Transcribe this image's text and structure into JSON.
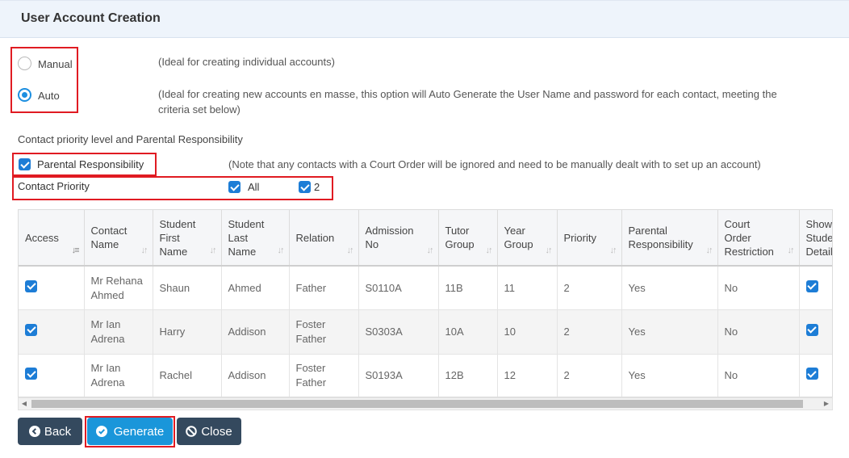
{
  "header": {
    "title": "User Account Creation"
  },
  "mode": {
    "manual": {
      "label": "Manual",
      "description": "(Ideal for creating individual accounts)",
      "selected": false
    },
    "auto": {
      "label": "Auto",
      "description_line1": "(Ideal for creating new accounts en masse, this option will Auto Generate the User Name and password for each contact, meeting the",
      "description_line2": "criteria set below)",
      "selected": true
    }
  },
  "priority_section": {
    "heading": "Contact priority level and Parental Responsibility",
    "parental_responsibility": {
      "label": "Parental Responsibility",
      "checked": true
    },
    "note": "(Note that any contacts with a Court Order will be ignored and need to be manually dealt with to set up an account)",
    "contact_priority": {
      "label": "Contact Priority",
      "options": [
        {
          "label": "All",
          "checked": true
        },
        {
          "label": "2",
          "checked": true
        }
      ]
    }
  },
  "table": {
    "columns": [
      {
        "l1": "Access",
        "l2": "",
        "l3": ""
      },
      {
        "l1": "Contact",
        "l2": "Name",
        "l3": ""
      },
      {
        "l1": "Student",
        "l2": "First",
        "l3": "Name"
      },
      {
        "l1": "Student",
        "l2": "Last",
        "l3": "Name"
      },
      {
        "l1": "Relation",
        "l2": "",
        "l3": ""
      },
      {
        "l1": "Admission",
        "l2": "No",
        "l3": ""
      },
      {
        "l1": "Tutor",
        "l2": "Group",
        "l3": ""
      },
      {
        "l1": "Year",
        "l2": "Group",
        "l3": ""
      },
      {
        "l1": "Priority",
        "l2": "",
        "l3": ""
      },
      {
        "l1": "Parental",
        "l2": "Responsibility",
        "l3": ""
      },
      {
        "l1": "Court",
        "l2": "Order",
        "l3": "Restriction"
      },
      {
        "l1": "Show",
        "l2": "Stude",
        "l3": "Detail"
      }
    ],
    "rows": [
      {
        "access": true,
        "contact_l1": "Mr Rehana",
        "contact_l2": "Ahmed",
        "first": "Shaun",
        "last": "Ahmed",
        "relation_l1": "Father",
        "relation_l2": "",
        "admission": "S0110A",
        "tutor": "11B",
        "year": "11",
        "priority": "2",
        "parental": "Yes",
        "court": "No",
        "show": true
      },
      {
        "access": true,
        "contact_l1": "Mr Ian",
        "contact_l2": "Adrena",
        "first": "Harry",
        "last": "Addison",
        "relation_l1": "Foster",
        "relation_l2": "Father",
        "admission": "S0303A",
        "tutor": "10A",
        "year": "10",
        "priority": "2",
        "parental": "Yes",
        "court": "No",
        "show": true
      },
      {
        "access": true,
        "contact_l1": "Mr Ian",
        "contact_l2": "Adrena",
        "first": "Rachel",
        "last": "Addison",
        "relation_l1": "Foster",
        "relation_l2": "Father",
        "admission": "S0193A",
        "tutor": "12B",
        "year": "12",
        "priority": "2",
        "parental": "Yes",
        "court": "No",
        "show": true
      }
    ]
  },
  "buttons": {
    "back": "Back",
    "generate": "Generate",
    "close": "Close"
  },
  "colors": {
    "accent": "#1d7dd6",
    "highlight": "#e01b22",
    "dark_button": "#34495e",
    "primary_button": "#1a96da"
  }
}
